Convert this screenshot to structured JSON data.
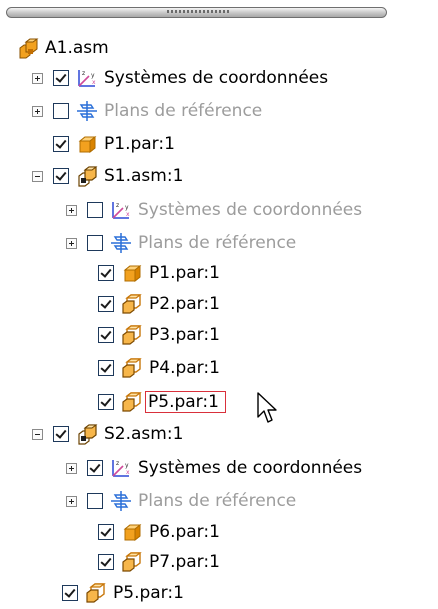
{
  "tree": {
    "root": {
      "label": "A1.asm",
      "icon": "assembly-icon"
    },
    "items": [
      {
        "label": "Systèmes de coordonnées",
        "icon": "coordinate-systems-icon",
        "checked": true,
        "dim": false
      },
      {
        "label": "Plans de référence",
        "icon": "reference-planes-icon",
        "checked": false,
        "dim": true
      },
      {
        "label": "P1.par:1",
        "icon": "part-icon",
        "checked": true
      },
      {
        "label": "S1.asm:1",
        "icon": "subassembly-icon",
        "checked": true,
        "expanded": true
      },
      {
        "label": "Systèmes de coordonnées",
        "icon": "coordinate-systems-icon",
        "checked": false,
        "dim": true
      },
      {
        "label": "Plans de référence",
        "icon": "reference-planes-icon",
        "checked": false,
        "dim": true
      },
      {
        "label": "P1.par:1",
        "icon": "part-icon",
        "checked": true
      },
      {
        "label": "P2.par:1",
        "icon": "part-link-icon",
        "checked": true
      },
      {
        "label": "P3.par:1",
        "icon": "part-link-icon",
        "checked": true
      },
      {
        "label": "P4.par:1",
        "icon": "part-link-icon",
        "checked": true
      },
      {
        "label": "P5.par:1",
        "icon": "part-link-icon",
        "checked": true,
        "selected": true
      },
      {
        "label": "S2.asm:1",
        "icon": "subassembly-icon",
        "checked": true,
        "expanded": true
      },
      {
        "label": "Systèmes de coordonnées",
        "icon": "coordinate-systems-icon",
        "checked": true,
        "dim": false
      },
      {
        "label": "Plans de référence",
        "icon": "reference-planes-icon",
        "checked": false,
        "dim": true
      },
      {
        "label": "P6.par:1",
        "icon": "part-icon",
        "checked": true
      },
      {
        "label": "P7.par:1",
        "icon": "part-link-icon",
        "checked": true
      },
      {
        "label": "P5.par:1",
        "icon": "part-link-icon",
        "checked": true
      }
    ]
  },
  "colors": {
    "part_orange": "#f2a11f",
    "plane_blue": "#2a6fd8",
    "selection_border": "#d9303b"
  }
}
